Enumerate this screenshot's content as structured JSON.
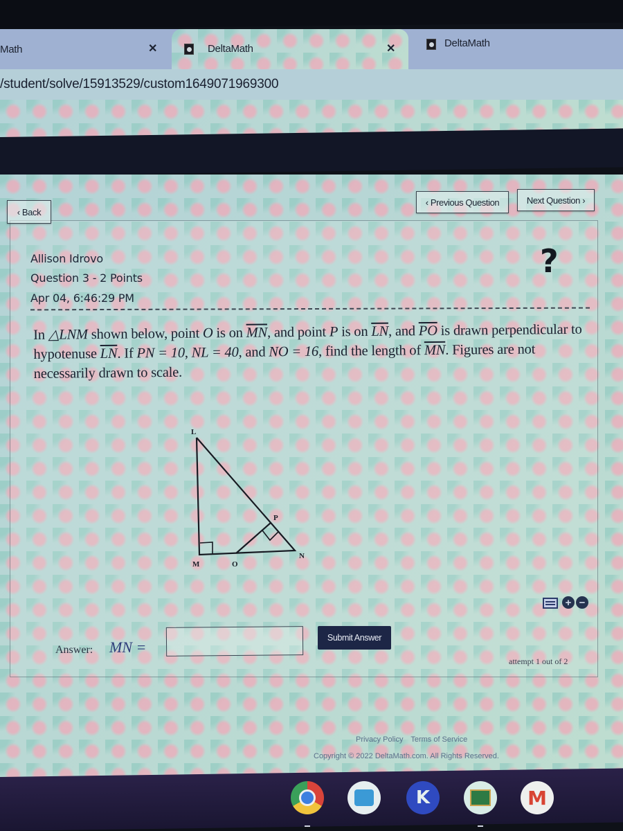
{
  "browser": {
    "tabs": [
      {
        "label": "Math",
        "active": false,
        "has_close": true
      },
      {
        "label": "DeltaMath",
        "active": true,
        "has_close": true
      },
      {
        "label": "DeltaMath",
        "active": false,
        "has_close": false
      }
    ],
    "close_glyph": "✕",
    "url": "/student/solve/15913529/custom1649071969300"
  },
  "nav": {
    "back_label": "‹ Back",
    "previous_label": "‹ Previous Question",
    "next_label": "Next Question ›"
  },
  "question": {
    "student_name": "Allison Idrovo",
    "points_label": "Question 3 - 2 Points",
    "timestamp": "Apr 04, 6:46:29 PM",
    "help_icon": "?",
    "prompt": {
      "t1": "In ",
      "tri": "△LNM",
      "t2": " shown below, point ",
      "O": "O",
      "t3": " is on ",
      "MN": "MN",
      "t4": ", and point ",
      "P": "P",
      "t5": " is on ",
      "LN": "LN",
      "t6": ", and ",
      "PO": "PO",
      "t7": " is drawn perpendicular to hypotenuse ",
      "LN2": "LN",
      "t8": ". If ",
      "eq1": "PN = 10",
      "t9": ", ",
      "eq2": "NL = 40",
      "t10": ", and ",
      "eq3": "NO = 16",
      "t11": ", find the length of ",
      "MN2": "MN",
      "t12": ". Figures are not necessarily drawn to scale."
    },
    "diagram_labels": {
      "L": "L",
      "M": "M",
      "N": "N",
      "O": "O",
      "P": "P"
    }
  },
  "answer": {
    "label": "Answer:",
    "variable": "MN =",
    "value": "",
    "submit_label": "Submit Answer",
    "attempt_text": "attempt 1 out of 2",
    "zoom_in": "+",
    "zoom_out": "−"
  },
  "footer": {
    "privacy": "Privacy Policy",
    "terms": "Terms of Service",
    "copyright": "Copyright © 2022 DeltaMath.com. All Rights Reserved."
  },
  "shelf": {
    "apps": [
      {
        "name": "chrome",
        "glyph": ""
      },
      {
        "name": "drive",
        "glyph": ""
      },
      {
        "name": "kami",
        "glyph": "K"
      },
      {
        "name": "classroom",
        "glyph": ""
      },
      {
        "name": "gmail",
        "glyph": "M"
      }
    ]
  }
}
